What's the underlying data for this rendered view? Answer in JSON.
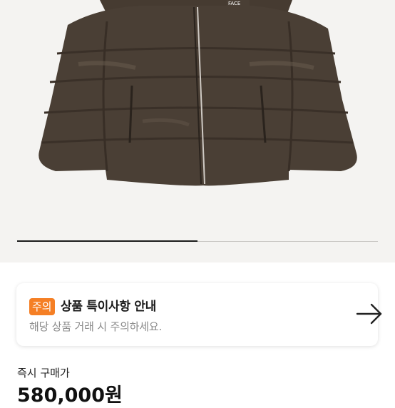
{
  "product_image": {
    "alt_icon": "puffer-jacket-image",
    "logo_text": "FACE",
    "carousel_progress": 0.5
  },
  "notice": {
    "tag": "주의",
    "title": "상품 특이사항 안내",
    "subtitle": "해당 상품 거래 시 주의하세요.",
    "arrow_icon": "arrow-right-icon"
  },
  "price": {
    "label": "즉시 구매가",
    "value": "580,000원"
  },
  "colors": {
    "tag": "#f57f25",
    "jacket": "#4a3f35",
    "background": "#f4f3f1"
  }
}
